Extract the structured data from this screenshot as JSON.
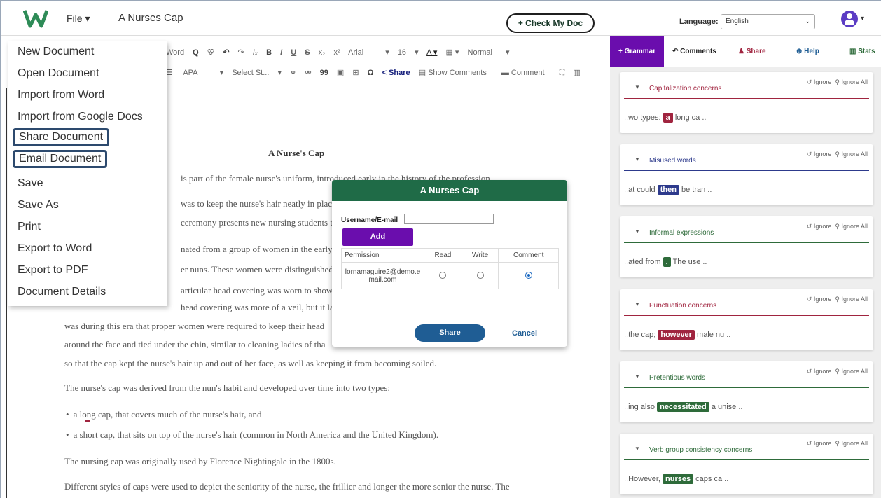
{
  "header": {
    "file_label": "File ▾",
    "doc_title": "A Nurses Cap",
    "check_label": "+ Check My Doc",
    "language_label": "Language:",
    "language_value": "English"
  },
  "toolbar": {
    "row1": [
      "Word",
      "Q",
      "ꕢ",
      "↶",
      "↷",
      "Iₓ",
      "B",
      "I",
      "U",
      "S",
      "x₂",
      "x²",
      "Arial",
      "▾",
      "16",
      "▾",
      "A ▾",
      "▦ ▾",
      "Normal",
      "▾"
    ],
    "row2": [
      "☰",
      "APA",
      "▾",
      "Select St...",
      "▾",
      "⚭",
      "⚮",
      "99",
      "▣",
      "⊞",
      "Ω"
    ],
    "share_label": "< Share",
    "show_comments_label": "Show Comments",
    "comment_label": "Comment"
  },
  "file_menu": {
    "items": [
      "New Document",
      "Open Document",
      "Import from Word",
      "Import from Google Docs",
      "Share Document",
      "Email Document",
      "Save",
      "Save As",
      "Print",
      "Export to Word",
      "Export to PDF",
      "Document Details"
    ]
  },
  "document": {
    "heading": "A Nurse's Cap",
    "lines": [
      "is part of the female nurse's uniform, introduced early in the history of the profession.",
      "was to keep the nurse's hair neatly in place a",
      "ceremony presents new nursing students th",
      "nated from a group of women in the early Cl",
      "er nuns. These women were distinguished fr",
      "articular head covering was worn to show th",
      "head covering was more of a veil, but it late",
      "was during this era that proper women were required to keep their head",
      "around the face and tied under the chin, similar to cleaning ladies of tha",
      "so that the cap kept the nurse's hair up and out of her face, as well as keeping it from becoming soiled.",
      "The nurse's cap was derived from the nun's habit and developed over time into two types:",
      "a long cap, that covers much of the nurse's hair, and",
      "a short cap, that sits on top of the nurse's hair (common in North America and the United Kingdom).",
      "The nursing cap was originally used by Florence Nightingale in the 1800s.",
      "Different styles of caps were used to depict the seniority of the nurse, the frillier and longer the more senior the nurse. The"
    ]
  },
  "modal": {
    "title": "A Nurses Cap",
    "username_label": "Username/E-mail",
    "add_label": "Add",
    "columns": [
      "Permission",
      "Read",
      "Write",
      "Comment"
    ],
    "row_email": "lornamaguire2@demo.email.com",
    "share_label": "Share",
    "cancel_label": "Cancel"
  },
  "right_panel": {
    "tabs": [
      "+ Grammar",
      "Comments",
      "Share",
      "Help",
      "Stats"
    ],
    "ignore_label": "Ignore",
    "ignore_all_label": "Ignore All",
    "cards": [
      {
        "title": "Capitalization concerns",
        "pre": "..wo types:",
        "tag": "a",
        "post": "long ca ..",
        "color": "#a0243f"
      },
      {
        "title": "Misused words",
        "pre": "..at could",
        "tag": "then",
        "post": "be tran ..",
        "color": "#2d3a8c"
      },
      {
        "title": "Informal expressions",
        "pre": "..ated from",
        "tag": ".",
        "post": "The use ..",
        "color": "#2e6b3a"
      },
      {
        "title": "Punctuation concerns",
        "pre": "..the cap;",
        "tag": "however",
        "post": "male nu ..",
        "color": "#a0243f"
      },
      {
        "title": "Pretentious words",
        "pre": "..ing also",
        "tag": "necessitated",
        "post": "a unise ..",
        "color": "#2e6b3a"
      },
      {
        "title": "Verb group consistency concerns",
        "pre": "..However,",
        "tag": "nurses",
        "post": "caps ca ..",
        "color": "#2e6b3a"
      }
    ]
  }
}
